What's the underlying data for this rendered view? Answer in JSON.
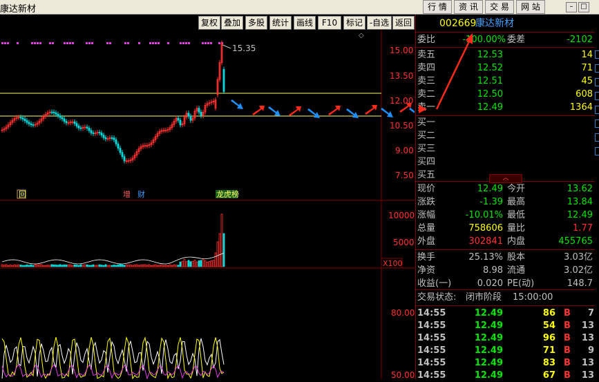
{
  "window": {
    "title": "康达新材"
  },
  "top_tabs": [
    "行 情",
    "资 讯",
    "交 易",
    "网 站"
  ],
  "toolbar": [
    "复权",
    "叠加",
    "多股",
    "统计",
    "画线",
    "F10",
    "标记",
    "-自选",
    "返回"
  ],
  "stock": {
    "code": "002669",
    "name": "康达新材"
  },
  "price_axis": [
    "15.00",
    "13.50",
    "12.00",
    "10.50",
    "9.00",
    "7.50"
  ],
  "peak_label": "15.35",
  "markers": [
    "回",
    "增",
    "财",
    "龙虎榜"
  ],
  "volume_axis": [
    "10000",
    "5000"
  ],
  "volume_unit": "X100",
  "ind_axis": [
    "80.00",
    "50.00"
  ],
  "colors": {
    "up": "#ff3232",
    "down": "#00e600",
    "text_yellow": "#ffff00",
    "text_gray": "#c0c0c0",
    "divider": "#800000",
    "arrow_red": "#ff2a1a",
    "arrow_blue": "#1e90ff"
  },
  "quote": {
    "weibi_label": "委比",
    "weibi": "-100.00%",
    "weicha_label": "委差",
    "weicha": "-2102",
    "sell": [
      {
        "label": "卖五",
        "price": "12.53",
        "vol": "14"
      },
      {
        "label": "卖四",
        "price": "12.52",
        "vol": "71"
      },
      {
        "label": "卖三",
        "price": "12.51",
        "vol": "45"
      },
      {
        "label": "卖二",
        "price": "12.50",
        "vol": "608"
      },
      {
        "label": "卖一",
        "price": "12.49",
        "vol": "1364"
      }
    ],
    "buy": [
      "买一",
      "买二",
      "买三",
      "买四",
      "买五"
    ]
  },
  "stats": [
    {
      "l": "现价",
      "v": "12.49",
      "vc": "#00e600",
      "l2": "今开",
      "v2": "13.62",
      "v2c": "#00e600"
    },
    {
      "l": "涨跌",
      "v": "-1.39",
      "vc": "#00e600",
      "l2": "最高",
      "v2": "13.84",
      "v2c": "#00e600"
    },
    {
      "l": "涨幅",
      "v": "-10.01%",
      "vc": "#00e600",
      "l2": "最低",
      "v2": "12.49",
      "v2c": "#00e600"
    },
    {
      "l": "总量",
      "v": "758606",
      "vc": "#ffff00",
      "l2": "量比",
      "v2": "1.77",
      "v2c": "#ff3232"
    },
    {
      "l": "外盘",
      "v": "302841",
      "vc": "#ff3232",
      "l2": "内盘",
      "v2": "455765",
      "v2c": "#00e600"
    },
    {
      "l": "换手",
      "v": "25.13%",
      "vc": "#c0c0c0",
      "l2": "股本",
      "v2": "3.03亿",
      "v2c": "#c0c0c0"
    },
    {
      "l": "净资",
      "v": "8.98",
      "vc": "#c0c0c0",
      "l2": "流通",
      "v2": "3.02亿",
      "v2c": "#c0c0c0"
    },
    {
      "l": "收益(一)",
      "v": "0.020",
      "vc": "#c0c0c0",
      "l2": "PE(动)",
      "v2": "148.7",
      "v2c": "#c0c0c0"
    }
  ],
  "trade_status": {
    "label": "交易状态:",
    "state": "闭市阶段",
    "time": "15:00:00"
  },
  "ticks": [
    {
      "t": "14:55",
      "p": "12.49",
      "v": "86",
      "bs": "B",
      "n": "7"
    },
    {
      "t": "14:55",
      "p": "12.49",
      "v": "54",
      "bs": "B",
      "n": "13"
    },
    {
      "t": "14:55",
      "p": "12.49",
      "v": "96",
      "bs": "B",
      "n": "13"
    },
    {
      "t": "14:55",
      "p": "12.49",
      "v": "71",
      "bs": "B",
      "n": "9"
    },
    {
      "t": "14:55",
      "p": "12.49",
      "v": "83",
      "bs": "B",
      "n": "13"
    },
    {
      "t": "14:55",
      "p": "12.49",
      "v": "67",
      "bs": "B",
      "n": "13"
    }
  ]
}
